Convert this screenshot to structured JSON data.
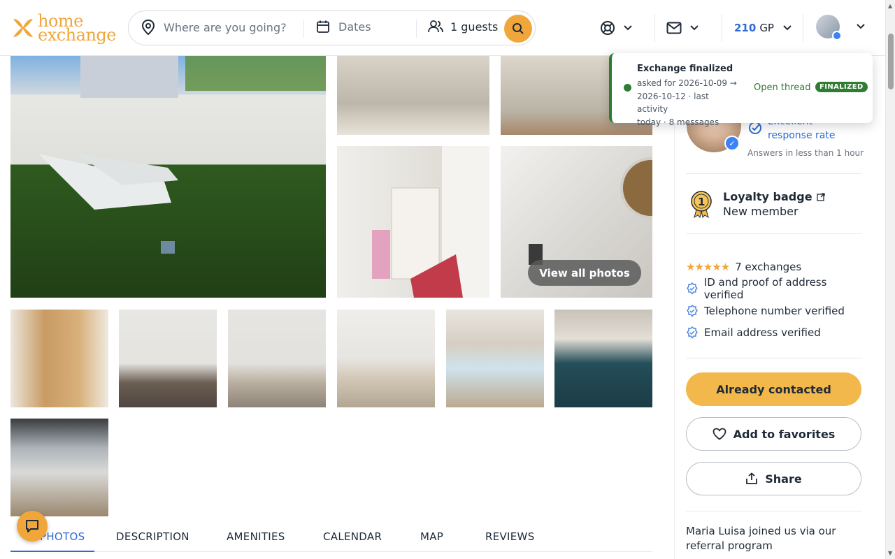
{
  "brand": {
    "name": "home exchange",
    "line1": "home",
    "line2": "exchange",
    "color": "#f0a63a"
  },
  "search": {
    "destination_placeholder": "Where are you going?",
    "dates_placeholder": "Dates",
    "guests_label": "1 guests"
  },
  "header": {
    "guest_points_value": "210",
    "guest_points_unit": "GP"
  },
  "gallery": {
    "view_all_label": "View all photos"
  },
  "tabs": [
    {
      "label": "PHOTOS",
      "active": true
    },
    {
      "label": "DESCRIPTION"
    },
    {
      "label": "AMENITIES"
    },
    {
      "label": "CALENDAR"
    },
    {
      "label": "MAP"
    },
    {
      "label": "REVIEWS"
    }
  ],
  "host": {
    "response_rate_label": "Excellent response rate",
    "response_time": "Answers in less than 1 hour",
    "loyalty_title": "Loyalty badge",
    "loyalty_level": "1",
    "loyalty_status": "New member",
    "rating_stars": 5,
    "exchanges": "7 exchanges",
    "verifications": [
      "ID and proof of address verified",
      "Telephone number verified",
      "Email address verified"
    ],
    "referral_note": "Maria Luisa joined us via our referral program"
  },
  "actions": {
    "contact_label": "Already contacted",
    "favorite_label": "Add to favorites",
    "share_label": "Share"
  },
  "toast": {
    "title": "Exchange finalized",
    "line1": "asked for 2026-10-09 →",
    "line2": "2026-10-12 · last activity",
    "line3": "today · 8 messages",
    "link_label": "Open thread",
    "badge": "FINALIZED",
    "color": "#2e7d32"
  },
  "colors": {
    "accent": "#f0a63a",
    "link": "#2f6bd6"
  }
}
